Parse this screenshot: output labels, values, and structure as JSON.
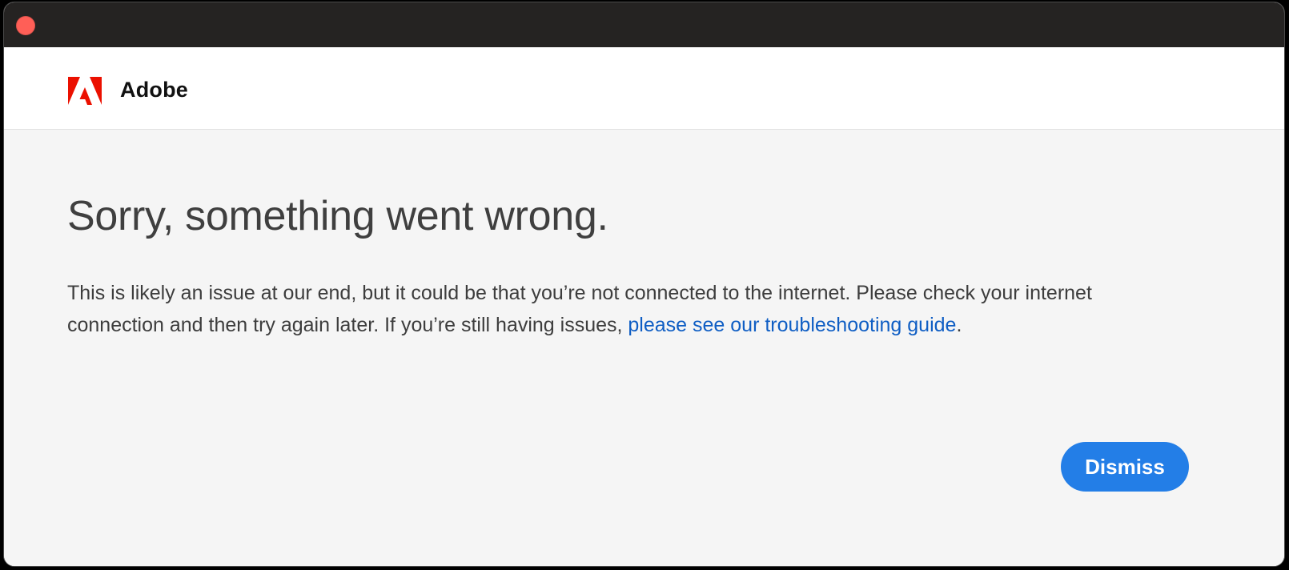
{
  "window": {
    "close_icon": "close-icon",
    "titlebar_color": "#252322",
    "close_color": "#ff5f57"
  },
  "header": {
    "logo_icon": "adobe-logo-icon",
    "brand_name": "Adobe",
    "logo_color": "#eb1000"
  },
  "error": {
    "title": "Sorry, something went wrong.",
    "message_part1": "This is likely an issue at our end, but it could be that you’re not connected to the internet. Please check your internet connection and then try again later. If you’re still having issues, ",
    "link_text": "please see our troubleshooting guide",
    "message_end": ".",
    "link_color": "#0f5ec4"
  },
  "actions": {
    "dismiss_label": "Dismiss",
    "dismiss_color": "#237ee7"
  }
}
